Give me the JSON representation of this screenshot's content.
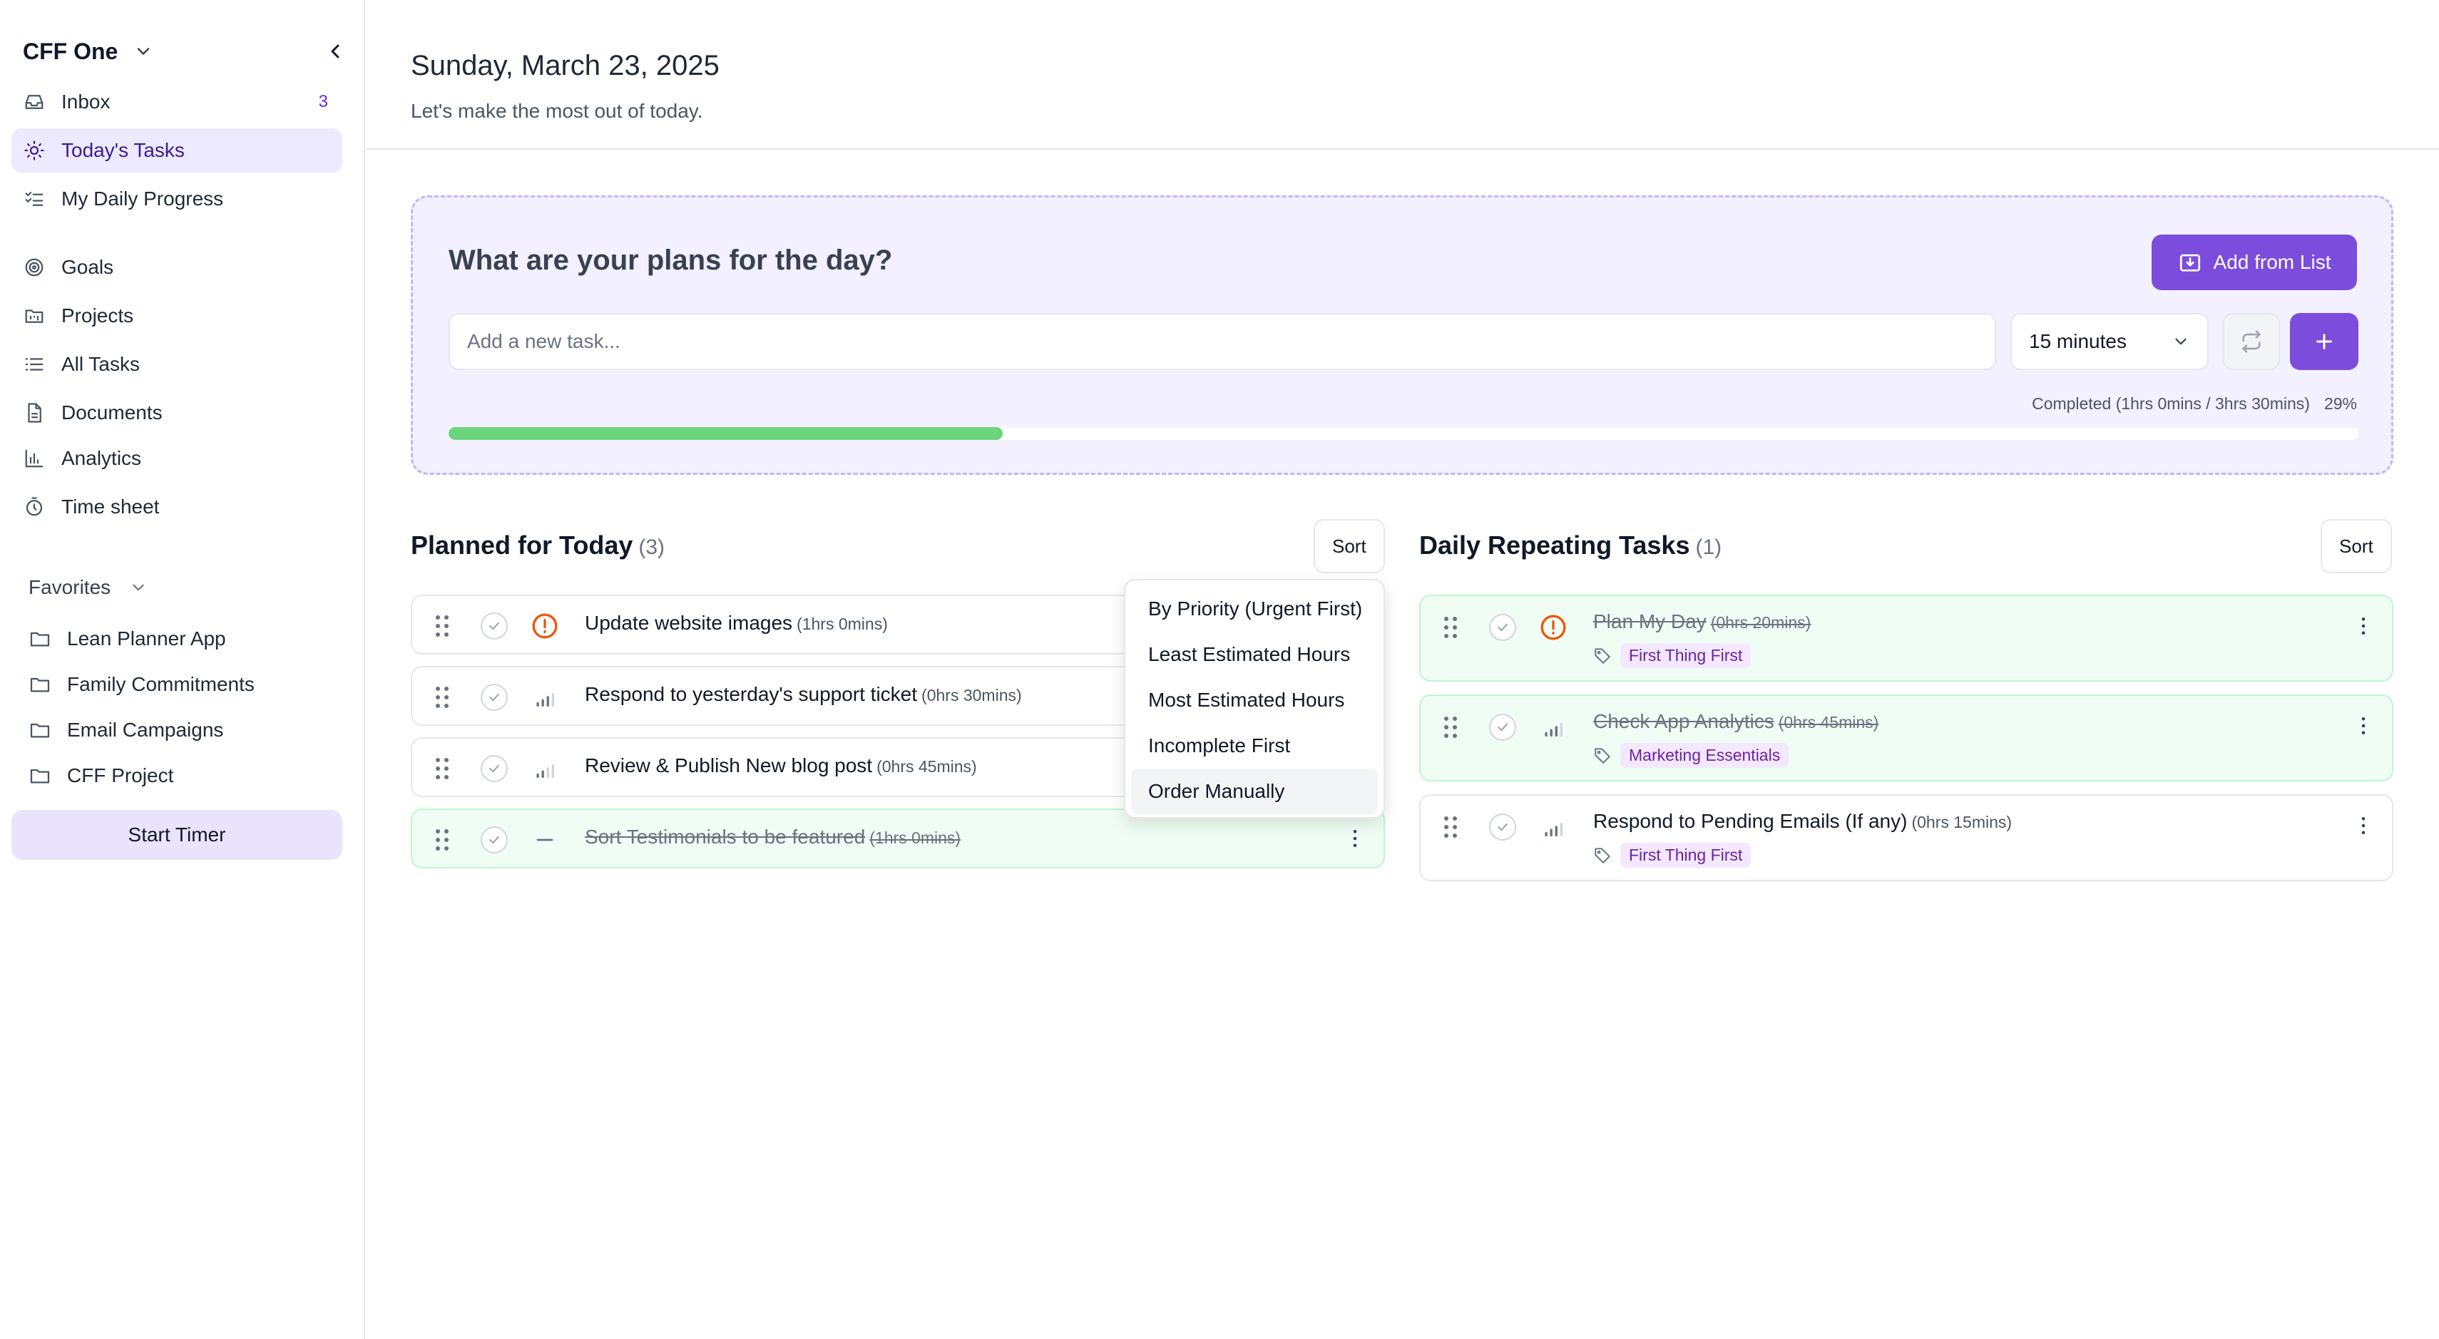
{
  "sidebar": {
    "workspace": "CFF One",
    "nav": [
      {
        "label": "Inbox",
        "count": "3",
        "icon": "inbox-icon"
      },
      {
        "label": "Today's Tasks",
        "icon": "sun-icon",
        "active": true
      },
      {
        "label": "My Daily Progress",
        "icon": "checklist-icon"
      },
      {
        "label": "Goals",
        "icon": "target-icon"
      },
      {
        "label": "Projects",
        "icon": "folder-kanban-icon"
      },
      {
        "label": "All Tasks",
        "icon": "list-icon"
      },
      {
        "label": "Documents",
        "icon": "document-icon"
      },
      {
        "label": "Analytics",
        "icon": "bar-chart-icon"
      },
      {
        "label": "Time sheet",
        "icon": "timer-icon"
      }
    ],
    "favorites_label": "Favorites",
    "favorites": [
      {
        "label": "Lean Planner App"
      },
      {
        "label": "Family Commitments"
      },
      {
        "label": "Email Campaigns"
      },
      {
        "label": "CFF Project"
      }
    ],
    "start_timer": "Start Timer"
  },
  "header": {
    "date": "Sunday, March 23, 2025",
    "subtitle": "Let's make the most out of today."
  },
  "plans": {
    "title": "What are your plans for the day?",
    "add_from_list": "Add from List",
    "input_placeholder": "Add a new task...",
    "duration": "15 minutes",
    "completed_text": "Completed (1hrs 0mins / 3hrs 30mins)",
    "percent": "29%",
    "progress_fraction": 0.29,
    "accent": "#7c4ddc",
    "progress_color": "#6dd47e"
  },
  "planned": {
    "title": "Planned for Today",
    "count": "(3)",
    "sort_label": "Sort",
    "tasks": [
      {
        "title": "Update website images",
        "estimate": "(1hrs 0mins)",
        "priority": "urgent-icon",
        "done": false
      },
      {
        "title": "Respond to yesterday's support ticket",
        "estimate": "(0hrs 30mins)",
        "priority": "priority-medium-icon",
        "done": false
      },
      {
        "title": "Review & Publish New blog post",
        "estimate": "(0hrs 45mins)",
        "priority": "priority-low-icon",
        "done": false
      },
      {
        "title": "Sort Testimonials to be featured",
        "estimate": "(1hrs 0mins)",
        "priority": "no-priority-icon",
        "done": true
      }
    ]
  },
  "repeating": {
    "title": "Daily Repeating Tasks",
    "count": "(1)",
    "sort_label": "Sort",
    "tasks": [
      {
        "title": "Plan My Day",
        "estimate": "(0hrs 20mins)",
        "tag": "First Thing First",
        "priority": "urgent-icon",
        "done": true
      },
      {
        "title": "Check App Analytics",
        "estimate": "(0hrs 45mins)",
        "tag": "Marketing Essentials",
        "priority": "priority-medium-icon",
        "done": true
      },
      {
        "title": "Respond to Pending Emails (If any)",
        "estimate": "(0hrs 15mins)",
        "tag": "First Thing First",
        "priority": "priority-medium-icon",
        "done": false
      }
    ]
  },
  "sort_menu": {
    "options": [
      "By Priority (Urgent First)",
      "Least Estimated Hours",
      "Most Estimated Hours",
      "Incomplete First",
      "Order Manually"
    ],
    "selected": "Order Manually"
  }
}
